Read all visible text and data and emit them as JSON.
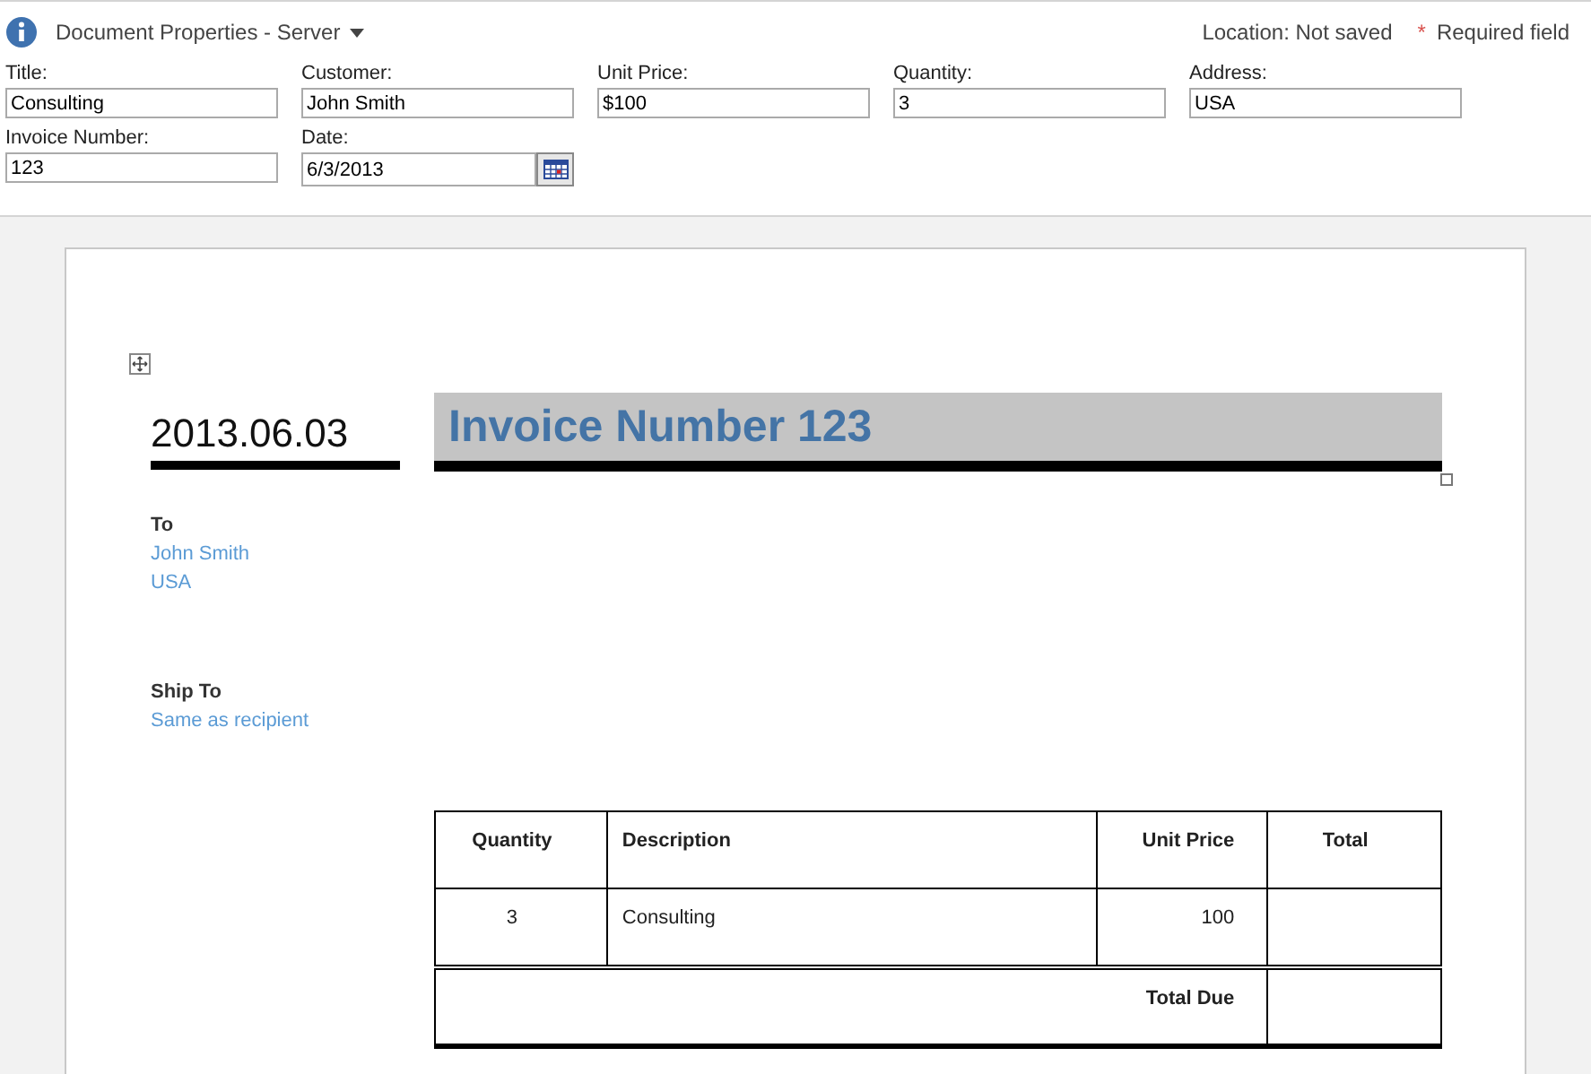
{
  "panel": {
    "title": "Document Properties - Server",
    "location": "Location: Not saved",
    "required_mark": "*",
    "required": "Required field"
  },
  "fields": [
    {
      "label": "Title:",
      "value": "Consulting",
      "kind": "text"
    },
    {
      "label": "Customer:",
      "value": "John Smith",
      "kind": "text"
    },
    {
      "label": "Unit Price:",
      "value": "$100",
      "kind": "text"
    },
    {
      "label": "Quantity:",
      "value": "3",
      "kind": "text"
    },
    {
      "label": "Address:",
      "value": "USA",
      "kind": "text"
    },
    {
      "label": "Invoice Number:",
      "value": "123",
      "kind": "text"
    },
    {
      "label": "Date:",
      "value": "6/3/2013",
      "kind": "date"
    }
  ],
  "document": {
    "date": "2013.06.03",
    "title": "Invoice Number 123",
    "to_label": "To",
    "to_lines": [
      "John Smith",
      "USA"
    ],
    "ship_label": "Ship To",
    "ship_lines": [
      "Same as recipient"
    ],
    "table": {
      "columns": [
        "Quantity",
        "Description",
        "Unit Price",
        "Total"
      ],
      "rows": [
        [
          "3",
          "Consulting",
          "100",
          ""
        ]
      ],
      "total_label": "Total Due"
    }
  }
}
